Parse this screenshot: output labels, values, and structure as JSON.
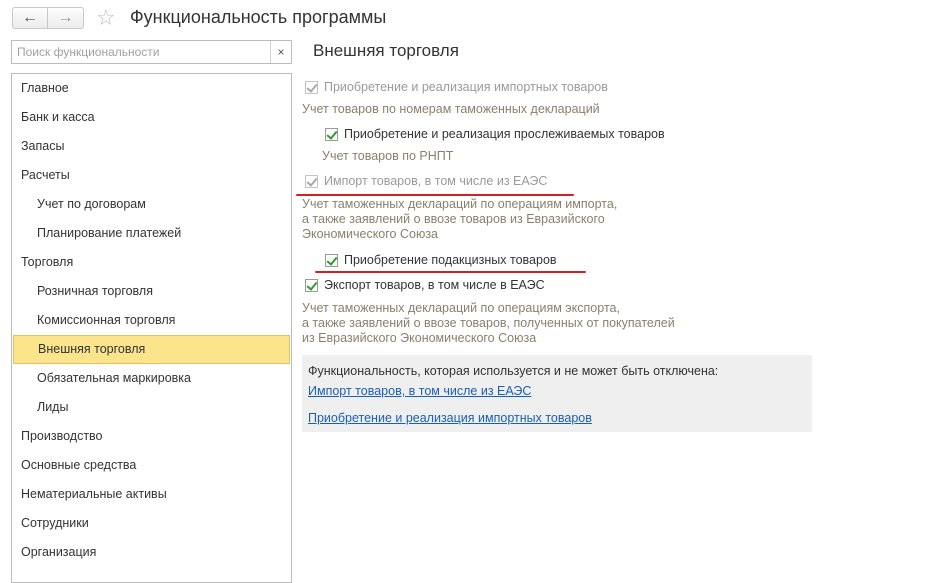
{
  "window": {
    "title": "Функциональность программы"
  },
  "search": {
    "placeholder": "Поиск функциональности",
    "clear_label": "×"
  },
  "sidebar": {
    "items": [
      {
        "label": "Главное"
      },
      {
        "label": "Банк и касса"
      },
      {
        "label": "Запасы"
      },
      {
        "label": "Расчеты"
      },
      {
        "label": "Учет по договорам"
      },
      {
        "label": "Планирование платежей"
      },
      {
        "label": "Торговля"
      },
      {
        "label": "Розничная торговля"
      },
      {
        "label": "Комиссионная торговля"
      },
      {
        "label": "Внешняя торговля"
      },
      {
        "label": "Обязательная маркировка"
      },
      {
        "label": "Лиды"
      },
      {
        "label": "Производство"
      },
      {
        "label": "Основные средства"
      },
      {
        "label": "Нематериальные активы"
      },
      {
        "label": "Сотрудники"
      },
      {
        "label": "Организация"
      }
    ],
    "active": "Внешняя торговля"
  },
  "main": {
    "section_title": "Внешняя торговля",
    "options": [
      {
        "label": "Приобретение и реализация импортных товаров",
        "checked": true,
        "enabled": false,
        "description": [
          "Учет товаров по номерам таможенных деклараций"
        ]
      },
      {
        "label": "Приобретение и реализация прослеживаемых товаров",
        "checked": true,
        "enabled": true,
        "description": [
          "Учет товаров по РНПТ"
        ]
      },
      {
        "label": "Импорт товаров, в том числе из ЕАЭС",
        "checked": true,
        "enabled": false,
        "description": [
          "Учет таможенных деклараций по операциям импорта,",
          "а также заявлений о ввозе товаров из Евразийского",
          "Экономического Союза"
        ]
      },
      {
        "label": "Приобретение подакцизных товаров",
        "checked": true,
        "enabled": true,
        "description": []
      },
      {
        "label": "Экспорт товаров, в том числе в ЕАЭС",
        "checked": true,
        "enabled": true,
        "description": [
          "Учет таможенных деклараций по операциям экспорта,",
          "а также заявлений о ввозе товаров, полученных от покупателей",
          "из Евразийского Экономического Союза"
        ]
      }
    ],
    "info": {
      "header": "Функциональность, которая используется и не может быть отключена:",
      "links": [
        "Импорт товаров, в том числе из ЕАЭС",
        "Приобретение и реализация импортных товаров"
      ]
    }
  },
  "colors": {
    "active_item_bg": "#fbe48c",
    "annotation_underline": "#d62020",
    "link": "#1a5fb4",
    "checkmark": "#2e9a2e"
  }
}
